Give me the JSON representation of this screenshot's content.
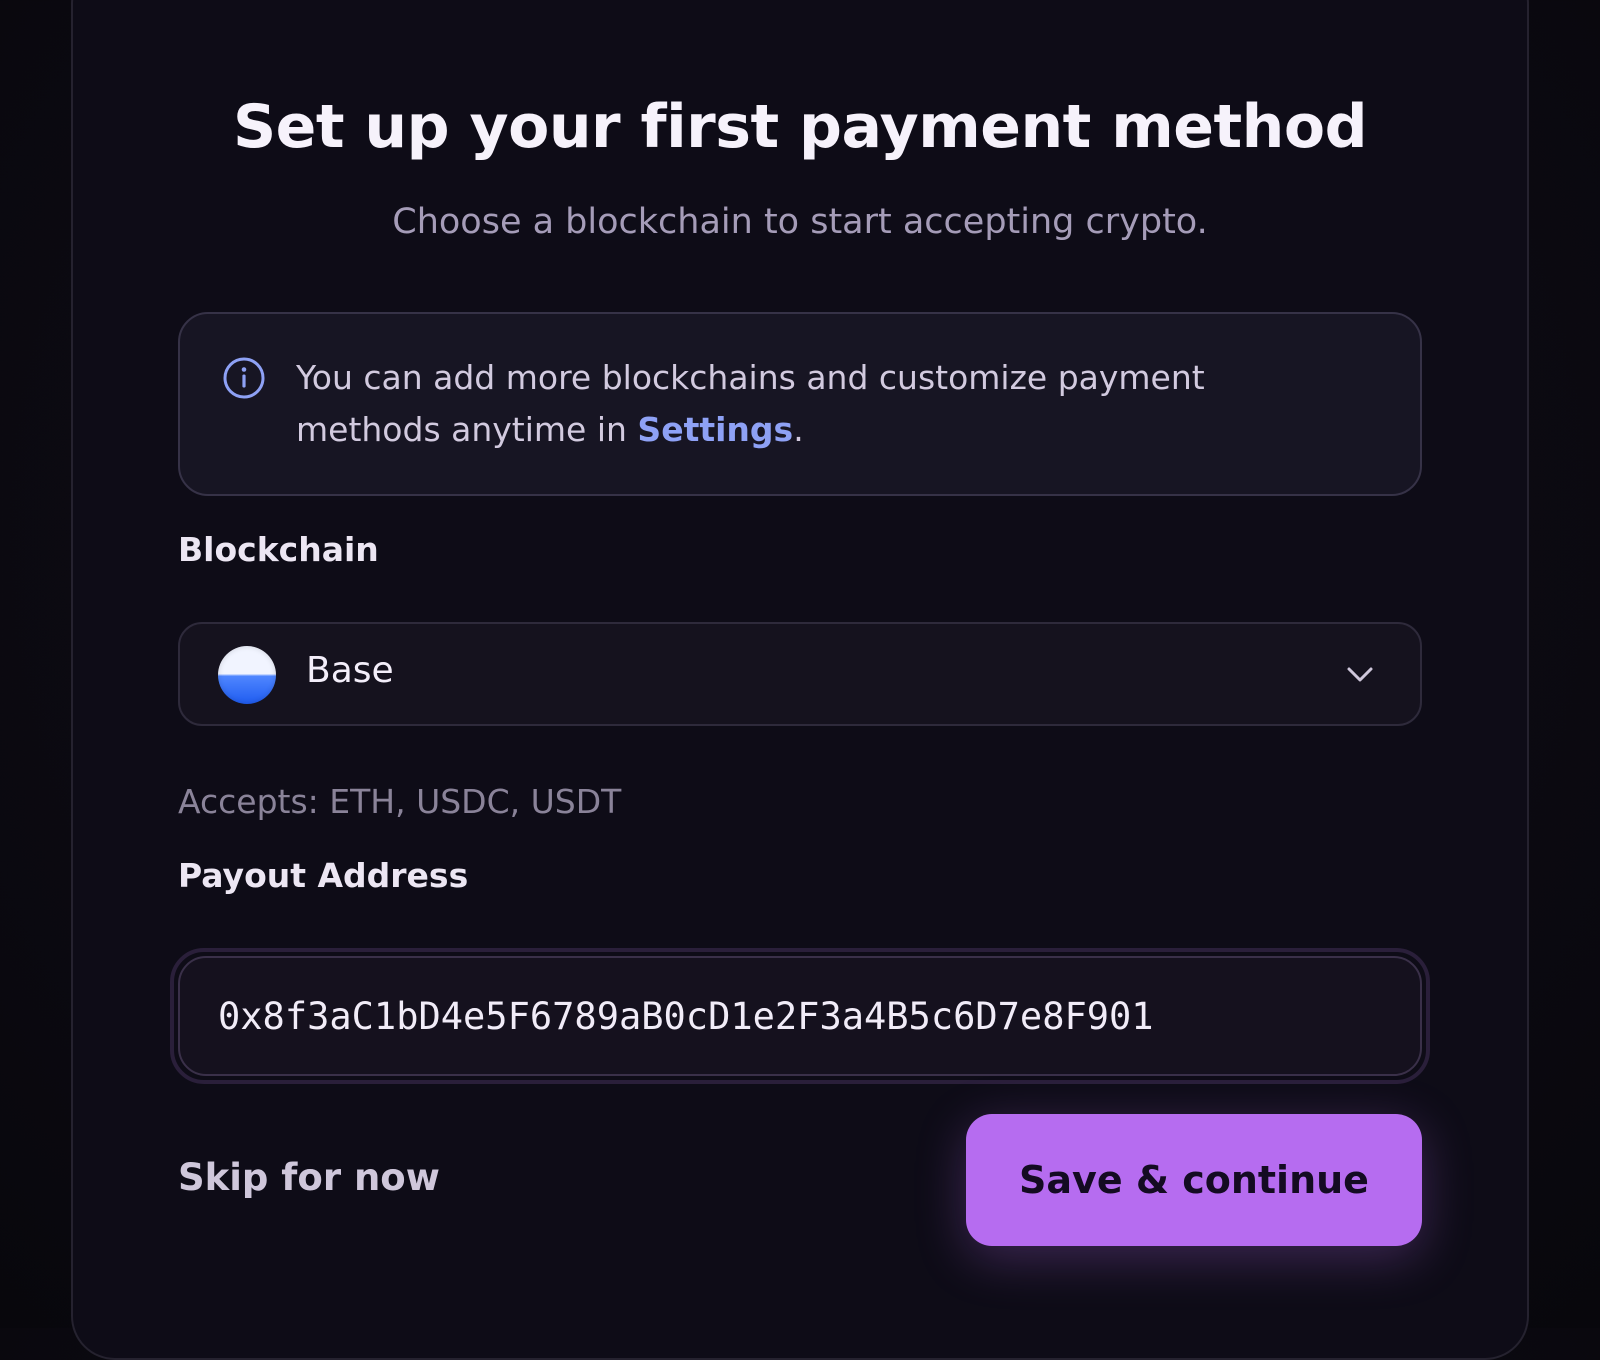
{
  "header": {
    "title": "Set up your first payment method",
    "subtitle": "Choose a blockchain to start accepting crypto."
  },
  "info": {
    "text_before": "You can add more blockchains and customize payment methods anytime in ",
    "link": "Settings",
    "text_after": ".",
    "icon": "info-icon"
  },
  "blockchain": {
    "label": "Blockchain",
    "selected": "Base",
    "logo_icon": "base-logo-icon",
    "chevron_icon": "chevron-down-icon",
    "accepts": "Accepts: ETH, USDC, USDT"
  },
  "payout": {
    "label": "Payout Address",
    "value": "0x8f3aC1bD4e5F6789aB0cD1e2F3a4B5c6D7e8F901"
  },
  "actions": {
    "skip_label": "Skip for now",
    "save_label": "Save & continue"
  },
  "colors": {
    "accent": "#b66cf0",
    "link": "#8ea1f5",
    "background": "#0e0c17"
  }
}
